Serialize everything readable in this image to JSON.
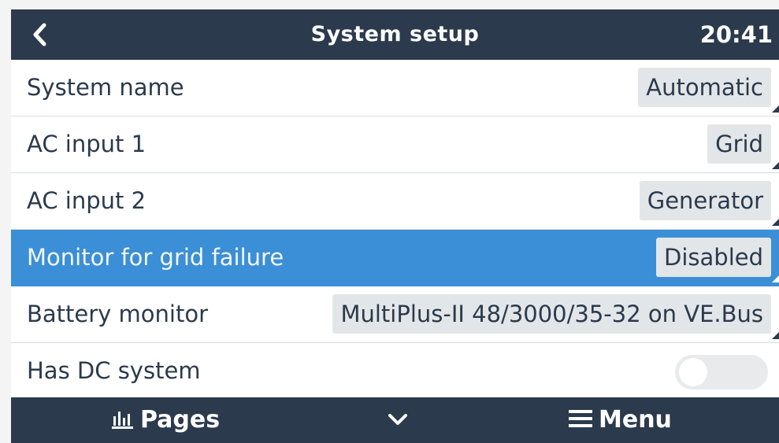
{
  "header": {
    "title": "System setup",
    "time": "20:41",
    "back_icon": "chevron-left-icon"
  },
  "settings": [
    {
      "label": "System name",
      "value": "Automatic",
      "control": "dropdown"
    },
    {
      "label": "AC input 1",
      "value": "Grid",
      "control": "dropdown"
    },
    {
      "label": "AC input 2",
      "value": "Generator",
      "control": "dropdown"
    },
    {
      "label": "Monitor for grid failure",
      "value": "Disabled",
      "control": "dropdown",
      "selected": true
    },
    {
      "label": "Battery monitor",
      "value": "MultiPlus-II 48/3000/35-32 on VE.Bus",
      "control": "dropdown"
    },
    {
      "label": "Has DC system",
      "control": "toggle",
      "enabled": false
    }
  ],
  "footer": {
    "pages_label": "Pages",
    "pages_icon": "bar-chart-icon",
    "nav_icon": "chevron-down-icon",
    "menu_label": "Menu",
    "menu_icon": "hamburger-icon"
  },
  "colors": {
    "header_bg": "#2b3a4c",
    "selected_row": "#3b8fd6",
    "value_box": "#e3e6e9",
    "text": "#2b3a4c"
  }
}
